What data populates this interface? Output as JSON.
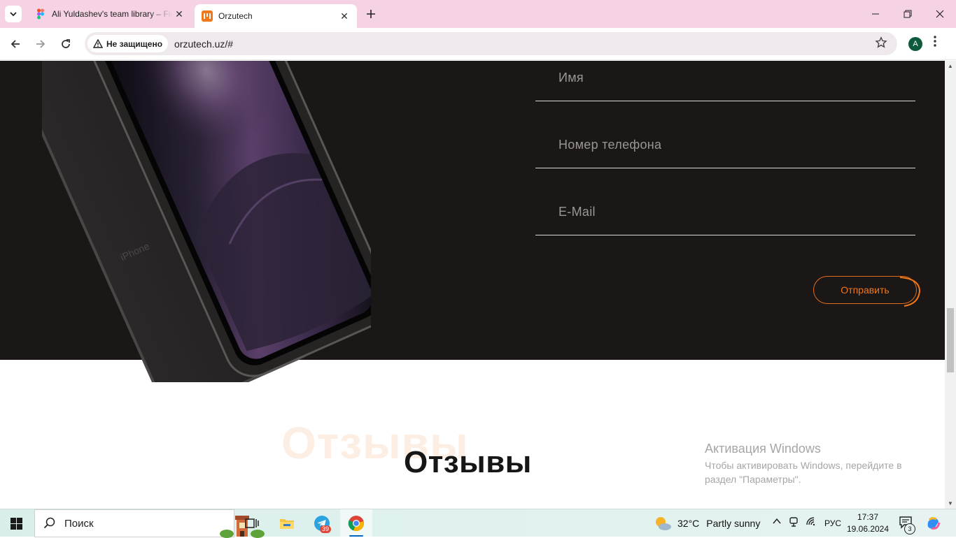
{
  "browser": {
    "tabs": [
      {
        "title": "Ali Yuldashev's team library – Figma",
        "active": false
      },
      {
        "title": "Orzutech",
        "active": true
      }
    ],
    "security_label": "Не защищено",
    "url": "orzutech.uz/#",
    "profile_initial": "A"
  },
  "form": {
    "name_placeholder": "Имя",
    "phone_placeholder": "Номер телефона",
    "email_placeholder": "E-Mail",
    "submit_label": "Отправить"
  },
  "reviews": {
    "background_text": "Отзывы",
    "title": "Отзывы"
  },
  "activation": {
    "title": "Активация Windows",
    "text": "Чтобы активировать Windows, перейдите в раздел \"Параметры\"."
  },
  "phone_engraving": "iPhone",
  "taskbar": {
    "search_label": "Поиск",
    "telegram_badge": "39",
    "weather_temp": "32°C",
    "weather_condition": "Partly sunny",
    "language": "РУС",
    "time": "17:37",
    "date": "19.06.2024",
    "notification_count": "3"
  },
  "colors": {
    "accent": "#f0781c",
    "dark_bg": "#1b1716",
    "tab_strip": "#f5d3e4"
  }
}
